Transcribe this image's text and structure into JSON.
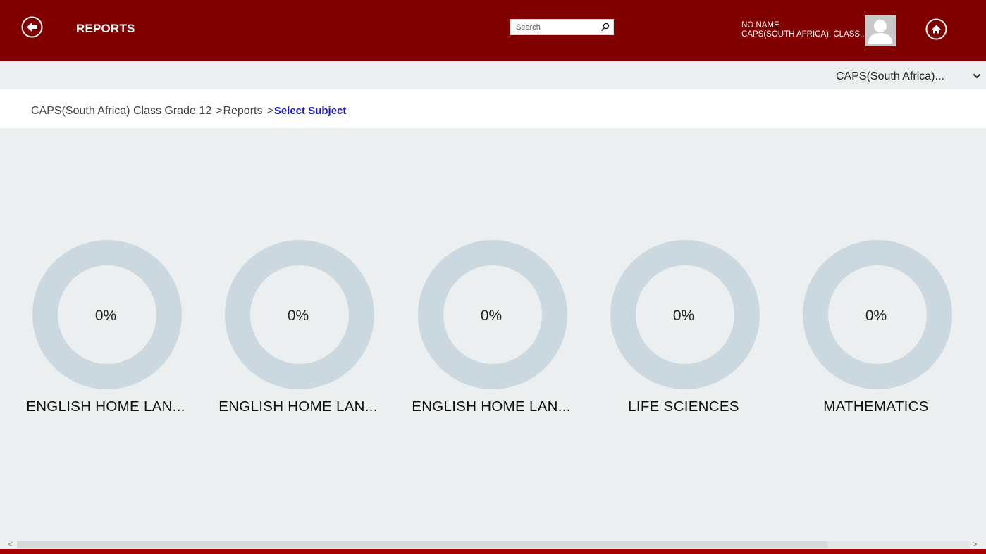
{
  "header": {
    "title": "REPORTS",
    "search_placeholder": "Search",
    "user_name": "NO NAME",
    "user_class": "CAPS(SOUTH AFRICA), CLASS..."
  },
  "subbar": {
    "board_selected": "CAPS(South Africa)..."
  },
  "breadcrumb": {
    "items": [
      "CAPS(South Africa) Class Grade 12",
      "Reports"
    ],
    "separator": ">",
    "current": "Select Subject"
  },
  "subjects": [
    {
      "name": "ENGLISH HOME LAN...",
      "progress": "0%"
    },
    {
      "name": "ENGLISH HOME LAN...",
      "progress": "0%"
    },
    {
      "name": "ENGLISH HOME LAN...",
      "progress": "0%"
    },
    {
      "name": "LIFE SCIENCES",
      "progress": "0%"
    },
    {
      "name": "MATHEMATICS",
      "progress": "0%"
    }
  ],
  "scrollbar": {
    "left_glyph": "<",
    "right_glyph": ">"
  },
  "colors": {
    "header_bg": "#800000",
    "ring": "#cbd8df",
    "breadcrumb_current": "#1a1acc"
  },
  "icons": {
    "back": "back-arrow-icon",
    "search": "search-icon",
    "avatar": "user-avatar-icon",
    "home": "home-icon",
    "dropdown": "chevron-down-icon"
  }
}
